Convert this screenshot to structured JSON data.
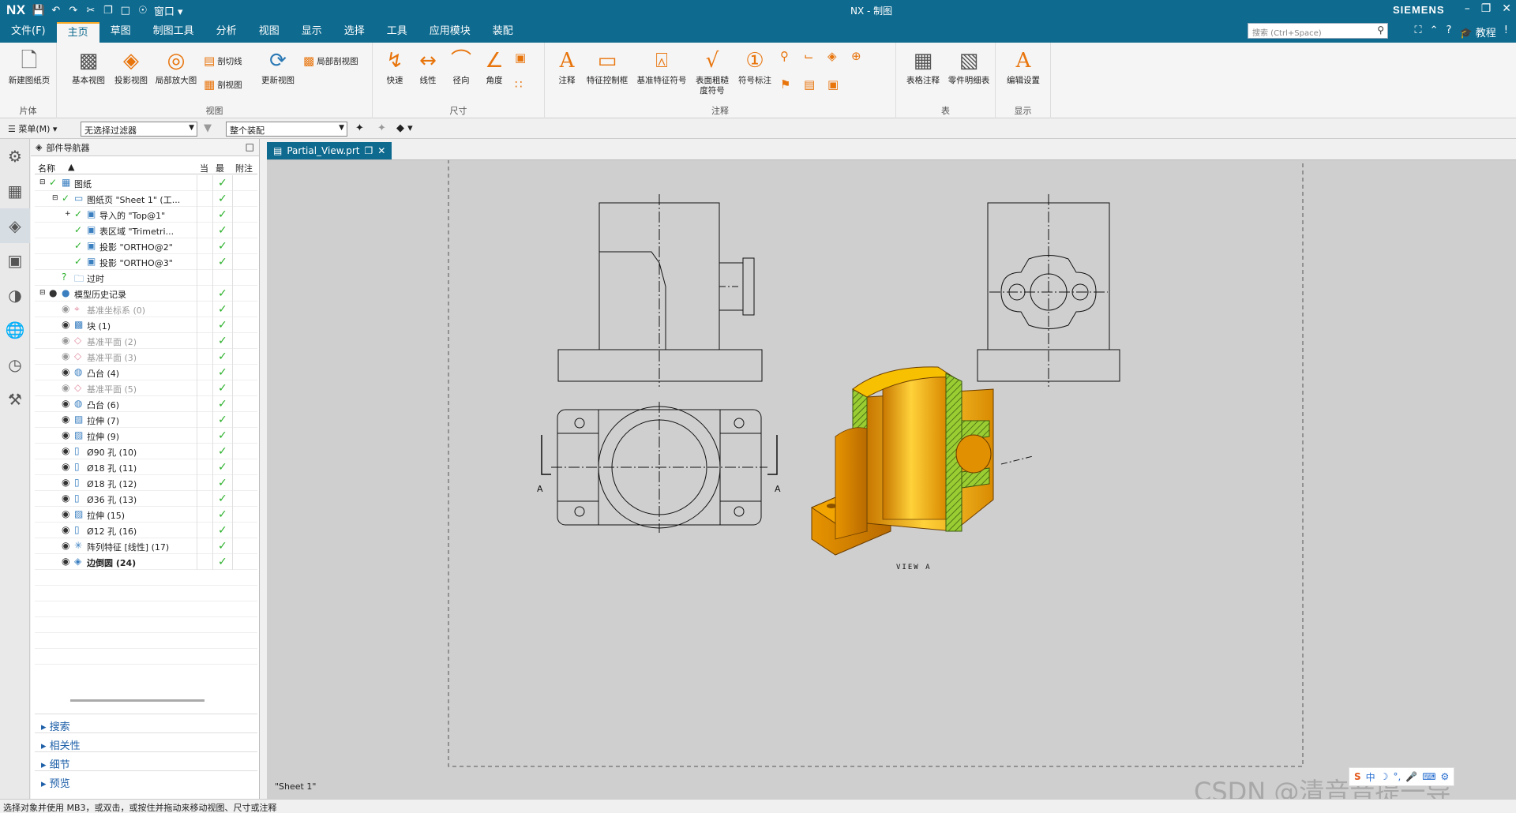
{
  "app": {
    "logo": "NX",
    "window_title": "NX - 制图",
    "brand": "SIEMENS",
    "window_menu": "窗口",
    "search_placeholder": "搜索 (Ctrl+Space)",
    "help_label": "教程"
  },
  "menu_tabs": [
    {
      "label": "文件(F)",
      "active": false
    },
    {
      "label": "主页",
      "active": true
    },
    {
      "label": "草图",
      "active": false
    },
    {
      "label": "制图工具",
      "active": false
    },
    {
      "label": "分析",
      "active": false
    },
    {
      "label": "视图",
      "active": false
    },
    {
      "label": "显示",
      "active": false
    },
    {
      "label": "选择",
      "active": false
    },
    {
      "label": "工具",
      "active": false
    },
    {
      "label": "应用模块",
      "active": false
    },
    {
      "label": "装配",
      "active": false
    }
  ],
  "ribbon": {
    "groups": {
      "sheet": "片体",
      "view": "视图",
      "dimension": "尺寸",
      "annotation": "注释",
      "table": "表",
      "display": "显示"
    },
    "buttons": {
      "new_sheet": "新建图纸页",
      "base_view": "基本视图",
      "projected_view": "投影视图",
      "detail_view": "局部放大图",
      "section_line": "剖切线",
      "section_view": "剖视图",
      "update_view": "更新视图",
      "break_out_section": "局部剖视图",
      "rapid": "快速",
      "linear": "线性",
      "radial": "径向",
      "angular": "角度",
      "note": "注释",
      "fcf": "特征控制框",
      "datum_symbol": "基准特征符号",
      "surface_finish_line1": "表面粗糙",
      "surface_finish_line2": "度符号",
      "id_symbol": "符号标注",
      "tabular_note": "表格注释",
      "parts_list": "零件明细表",
      "edit_settings": "编辑设置"
    }
  },
  "selection_bar": {
    "menu": "菜单(M)",
    "filter": "无选择过滤器",
    "scope": "整个装配"
  },
  "navigator": {
    "title": "部件导航器",
    "columns": {
      "name": "名称",
      "current": "当",
      "latest": "最",
      "comment": "附注"
    },
    "rows": [
      {
        "label": "图纸",
        "indent": 0,
        "style": "normal",
        "icon": "drawing-icon",
        "check": true
      },
      {
        "label": "图纸页 \"Sheet 1\" (工...",
        "indent": 1,
        "style": "normal",
        "icon": "sheet-icon",
        "check": true
      },
      {
        "label": "导入的 \"Top@1\"",
        "indent": 2,
        "style": "normal",
        "icon": "view-icon",
        "check": true
      },
      {
        "label": "表区域 \"Trimetri...",
        "indent": 2,
        "style": "normal",
        "icon": "view-icon",
        "check": true
      },
      {
        "label": "投影 \"ORTHO@2\"",
        "indent": 2,
        "style": "normal",
        "icon": "view-icon",
        "check": true
      },
      {
        "label": "投影 \"ORTHO@3\"",
        "indent": 2,
        "style": "normal",
        "icon": "view-icon",
        "check": true
      },
      {
        "label": "过时",
        "indent": 1,
        "style": "normal",
        "icon": "folder-icon",
        "check": false
      },
      {
        "label": "模型历史记录",
        "indent": 0,
        "style": "normal",
        "icon": "history-icon",
        "check": true
      },
      {
        "label": "基准坐标系 (0)",
        "indent": 1,
        "style": "grey",
        "icon": "csys-icon",
        "check": true
      },
      {
        "label": "块 (1)",
        "indent": 1,
        "style": "normal",
        "icon": "block-icon",
        "check": true
      },
      {
        "label": "基准平面 (2)",
        "indent": 1,
        "style": "grey",
        "icon": "plane-icon",
        "check": true
      },
      {
        "label": "基准平面 (3)",
        "indent": 1,
        "style": "grey",
        "icon": "plane-icon",
        "check": true
      },
      {
        "label": "凸台 (4)",
        "indent": 1,
        "style": "normal",
        "icon": "boss-icon",
        "check": true
      },
      {
        "label": "基准平面 (5)",
        "indent": 1,
        "style": "grey",
        "icon": "plane-icon",
        "check": true
      },
      {
        "label": "凸台 (6)",
        "indent": 1,
        "style": "normal",
        "icon": "boss-icon",
        "check": true
      },
      {
        "label": "拉伸 (7)",
        "indent": 1,
        "style": "normal",
        "icon": "extrude-icon",
        "check": true
      },
      {
        "label": "拉伸 (9)",
        "indent": 1,
        "style": "normal",
        "icon": "extrude-icon",
        "check": true
      },
      {
        "label": "Ø90 孔 (10)",
        "indent": 1,
        "style": "normal",
        "icon": "hole-icon",
        "check": true
      },
      {
        "label": "Ø18 孔 (11)",
        "indent": 1,
        "style": "normal",
        "icon": "hole-icon",
        "check": true
      },
      {
        "label": "Ø18 孔 (12)",
        "indent": 1,
        "style": "normal",
        "icon": "hole-icon",
        "check": true
      },
      {
        "label": "Ø36 孔 (13)",
        "indent": 1,
        "style": "normal",
        "icon": "hole-icon",
        "check": true
      },
      {
        "label": "拉伸 (15)",
        "indent": 1,
        "style": "normal",
        "icon": "extrude-icon",
        "check": true
      },
      {
        "label": "Ø12 孔 (16)",
        "indent": 1,
        "style": "normal",
        "icon": "hole-icon",
        "check": true
      },
      {
        "label": "阵列特征 [线性] (17)",
        "indent": 1,
        "style": "normal",
        "icon": "pattern-icon",
        "check": true
      },
      {
        "label": "边倒圆 (24)",
        "indent": 1,
        "style": "bold",
        "icon": "blend-icon",
        "check": true
      }
    ],
    "sections": [
      "搜索",
      "相关性",
      "细节",
      "预览"
    ]
  },
  "document_tab": "Partial_View.prt",
  "drawing": {
    "sheet_label": "\"Sheet 1\"",
    "section_label_left": "A",
    "section_label_right": "A",
    "view_label": "VIEW A"
  },
  "status_text": "选择对象并使用 MB3，或双击，或按住并拖动来移动视图、尺寸或注释",
  "watermark": "CSDN @清音音提一导",
  "ime": {
    "logo": "S",
    "lang": "中"
  },
  "colors": {
    "accent": "#0e6a8f",
    "check": "#2cb12c",
    "model_orange": "#f0a000",
    "hatch_green": "#9acd32"
  }
}
